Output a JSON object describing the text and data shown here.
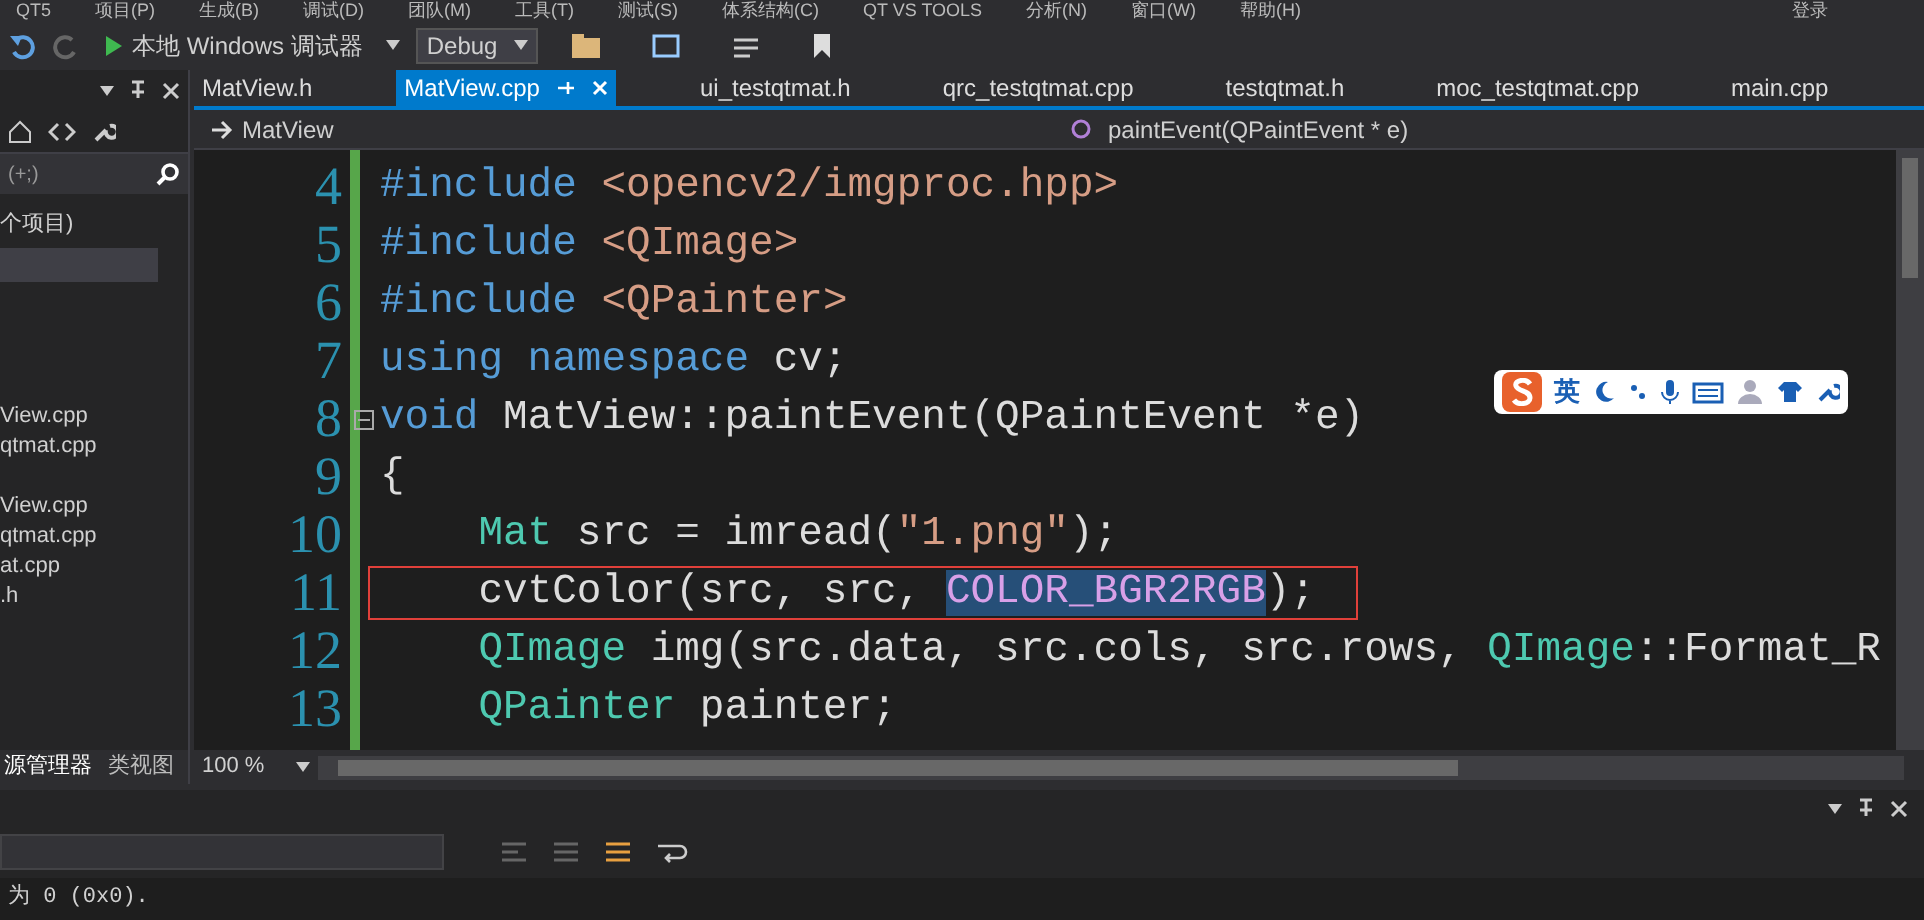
{
  "menu": [
    "QT5",
    "项目(P)",
    "生成(B)",
    "调试(D)",
    "团队(M)",
    "工具(T)",
    "测试(S)",
    "体系结构(C)",
    "QT VS TOOLS",
    "分析(N)",
    "窗口(W)",
    "帮助(H)"
  ],
  "account": "登录",
  "toolbar": {
    "debugger": "本地 Windows 调试器",
    "configuration": "Debug"
  },
  "sidebar": {
    "search_hint": "(+;)",
    "items": [
      {
        "label": "个项目)",
        "selected": false
      },
      {
        "label": "View.cpp",
        "selected": false
      },
      {
        "label": "qtmat.cpp",
        "selected": false
      },
      {
        "label": "View.cpp",
        "selected": false
      },
      {
        "label": "qtmat.cpp",
        "selected": false
      },
      {
        "label": "at.cpp",
        "selected": false
      },
      {
        "label": ".h",
        "selected": false
      }
    ],
    "selection_bar": true,
    "bottom_tabs": [
      {
        "label": "源管理器",
        "selected": true
      },
      {
        "label": "类视图",
        "selected": false
      }
    ]
  },
  "tabs": [
    {
      "label": "MatView.h",
      "selected": false
    },
    {
      "label": "MatView.cpp",
      "selected": true
    },
    {
      "label": "ui_testqtmat.h",
      "selected": false
    },
    {
      "label": "qrc_testqtmat.cpp",
      "selected": false
    },
    {
      "label": "testqtmat.h",
      "selected": false
    },
    {
      "label": "moc_testqtmat.cpp",
      "selected": false
    },
    {
      "label": "main.cpp",
      "selected": false
    }
  ],
  "navigation": {
    "scope": "MatView",
    "member": "paintEvent(QPaintEvent * e)"
  },
  "code": [
    {
      "number": "4",
      "boxed": false,
      "collapsible": false,
      "tokens": [
        {
          "kind": "keyword",
          "text": "#include",
          "selected": false
        },
        {
          "kind": "string",
          "text": " <opencv2/imgproc.hpp>",
          "selected": false
        }
      ]
    },
    {
      "number": "5",
      "boxed": false,
      "collapsible": false,
      "tokens": [
        {
          "kind": "keyword",
          "text": "#include",
          "selected": false
        },
        {
          "kind": "string",
          "text": " <QImage>",
          "selected": false
        }
      ]
    },
    {
      "number": "6",
      "boxed": false,
      "collapsible": false,
      "tokens": [
        {
          "kind": "keyword",
          "text": "#include",
          "selected": false
        },
        {
          "kind": "string",
          "text": " <QPainter>",
          "selected": false
        }
      ]
    },
    {
      "number": "7",
      "boxed": false,
      "collapsible": false,
      "tokens": [
        {
          "kind": "keyword",
          "text": "using namespace",
          "selected": false
        },
        {
          "kind": "plain",
          "text": " cv;",
          "selected": false
        }
      ]
    },
    {
      "number": "8",
      "boxed": false,
      "collapsible": true,
      "tokens": [
        {
          "kind": "keyword",
          "text": "void",
          "selected": false
        },
        {
          "kind": "plain",
          "text": " MatView::paintEvent(QPaintEvent *e)",
          "selected": false
        }
      ]
    },
    {
      "number": "9",
      "boxed": false,
      "collapsible": false,
      "tokens": [
        {
          "kind": "plain",
          "text": "{",
          "selected": false
        }
      ]
    },
    {
      "number": "10",
      "boxed": false,
      "collapsible": false,
      "tokens": [
        {
          "kind": "type",
          "text": "    Mat",
          "selected": false
        },
        {
          "kind": "plain",
          "text": " src = imread(",
          "selected": false
        },
        {
          "kind": "string",
          "text": "\"1.png\"",
          "selected": false
        },
        {
          "kind": "plain",
          "text": ");",
          "selected": false
        }
      ]
    },
    {
      "number": "11",
      "boxed": true,
      "collapsible": false,
      "tokens": [
        {
          "kind": "plain",
          "text": "    cvtColor(src, src, ",
          "selected": false
        },
        {
          "kind": "macro",
          "text": "COLOR_BGR2RGB",
          "selected": true
        },
        {
          "kind": "plain",
          "text": ");",
          "selected": false
        }
      ]
    },
    {
      "number": "12",
      "boxed": false,
      "collapsible": false,
      "tokens": [
        {
          "kind": "type",
          "text": "    QImage",
          "selected": false
        },
        {
          "kind": "plain",
          "text": " img(src.data, src.cols, src.rows, ",
          "selected": false
        },
        {
          "kind": "type",
          "text": "QImage",
          "selected": false
        },
        {
          "kind": "plain",
          "text": "::Format_R",
          "selected": false
        }
      ]
    },
    {
      "number": "13",
      "boxed": false,
      "collapsible": false,
      "tokens": [
        {
          "kind": "type",
          "text": "    QPainter",
          "selected": false
        },
        {
          "kind": "plain",
          "text": " painter;",
          "selected": false
        }
      ]
    }
  ],
  "ime_toolbar": {
    "mode": "英"
  },
  "zoom": "100 %",
  "output": {
    "lines": [
      "为 0 (0x0)."
    ]
  }
}
